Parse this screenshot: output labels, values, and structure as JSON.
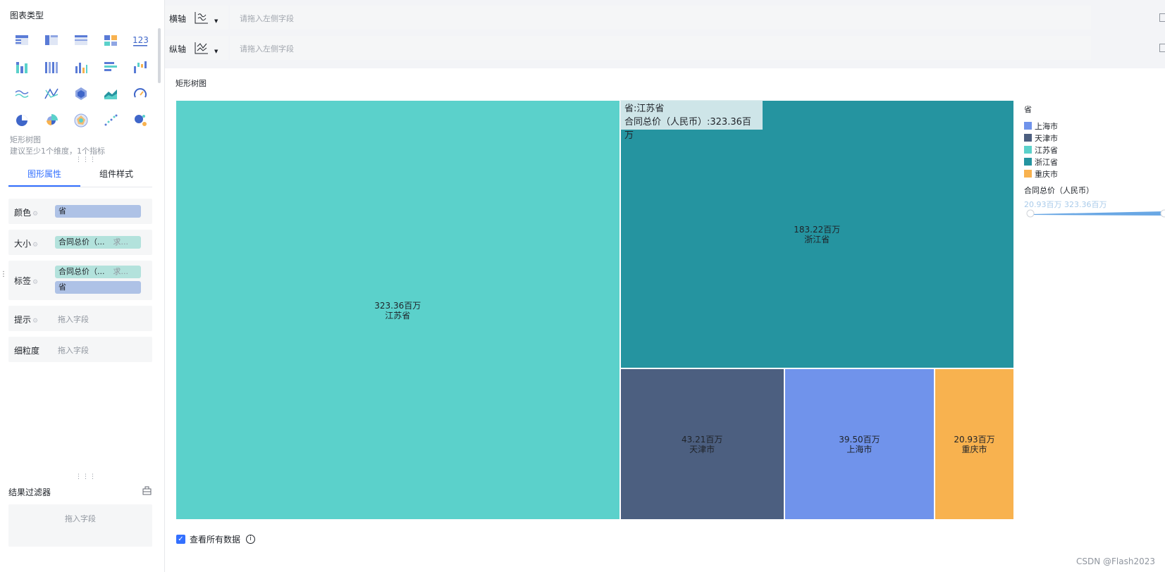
{
  "sidebar": {
    "chart_type_title": "图表类型",
    "chart_icons": [
      "table-icon",
      "cross-table-icon",
      "detail-table-icon",
      "grouped-table-icon",
      "kpi-number-icon",
      "stacked-column-icon",
      "percent-column-icon",
      "column-chart-icon",
      "bar-chart-icon",
      "waterfall-chart-icon",
      "line-chart-icon",
      "dual-axis-line-icon",
      "polygon-icon",
      "area-chart-icon",
      "gauge-icon",
      "pie-chart-icon",
      "rose-chart-icon",
      "radar-chart-icon",
      "scatter-chart-icon",
      "bubble-chart-icon"
    ],
    "kpi_text": "123",
    "selected_chart_name": "矩形树图",
    "selected_chart_hint": "建议至少1个维度，1个指标",
    "tabs": [
      "图形属性",
      "组件样式"
    ],
    "props": {
      "color": {
        "label": "颜色",
        "pill": "省"
      },
      "size": {
        "label": "大小",
        "pill": "合同总价（...",
        "agg": "求..."
      },
      "label": {
        "label": "标签",
        "pill1": "合同总价（...",
        "agg1": "求...",
        "pill2": "省"
      },
      "tooltip": {
        "label": "提示",
        "placeholder": "拖入字段"
      },
      "granularity": {
        "label": "细粒度",
        "placeholder": "拖入字段"
      }
    },
    "filter_title": "结果过滤器",
    "filter_placeholder": "拖入字段"
  },
  "axes": {
    "x": {
      "label": "横轴",
      "placeholder": "请拖入左侧字段"
    },
    "y": {
      "label": "纵轴",
      "placeholder": "请拖入左侧字段"
    }
  },
  "chart_title": "矩形树图",
  "chart_data": {
    "type": "treemap",
    "measure": "合同总价（人民币）",
    "dimension": "省",
    "nodes": [
      {
        "name": "江苏省",
        "value": 323.36,
        "label": "323.36百万",
        "color": "#5bd1cb"
      },
      {
        "name": "浙江省",
        "value": 183.22,
        "label": "183.22百万",
        "color": "#2594a0"
      },
      {
        "name": "天津市",
        "value": 43.21,
        "label": "43.21百万",
        "color": "#4c5f80"
      },
      {
        "name": "上海市",
        "value": 39.5,
        "label": "39.50百万",
        "color": "#7093eb"
      },
      {
        "name": "重庆市",
        "value": 20.93,
        "label": "20.93百万",
        "color": "#f8b24f"
      }
    ]
  },
  "tooltip": {
    "line1": "省:江苏省",
    "line2": "合同总价（人民币）:323.36百万"
  },
  "legend": {
    "title": "省",
    "items": [
      {
        "name": "上海市",
        "color": "#7093eb"
      },
      {
        "name": "天津市",
        "color": "#4c5f80"
      },
      {
        "name": "江苏省",
        "color": "#5bd1cb"
      },
      {
        "name": "浙江省",
        "color": "#2594a0"
      },
      {
        "name": "重庆市",
        "color": "#f8b24f"
      }
    ],
    "size_title": "合同总价（人民币）",
    "size_range": "20.93百万 323.36百万"
  },
  "footer": {
    "checkbox_label": "查看所有数据",
    "checked": true
  },
  "watermark": "CSDN @Flash2023"
}
